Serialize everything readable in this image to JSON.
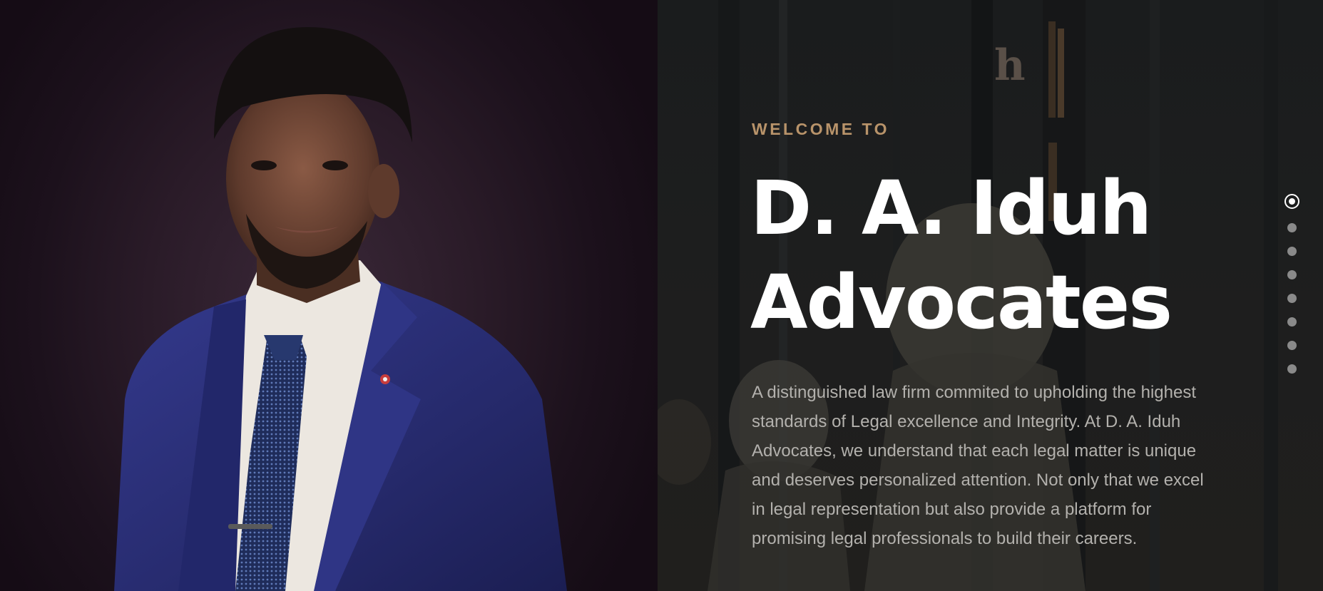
{
  "hero": {
    "eyebrow": "WELCOME TO",
    "title_line1": "D. A. Iduh",
    "title_line2": "Advocates",
    "description": "A distinguished law firm commited to upholding the highest standards of Legal excellence and Integrity. At D. A. Iduh Advocates, we understand that each legal matter is unique and deserves personalized attention. Not only that we excel in legal representation but also provide a platform for promising legal professionals to build their careers."
  },
  "slider": {
    "total_slides": 8,
    "active_slide": 1
  },
  "colors": {
    "accent": "#b8936a",
    "title": "#ffffff",
    "body_text": "#b3b1ad",
    "suit": "#2b2f7a"
  },
  "icons": {
    "background_left": "portrait-photo",
    "background_right": "library-busts-photo"
  }
}
